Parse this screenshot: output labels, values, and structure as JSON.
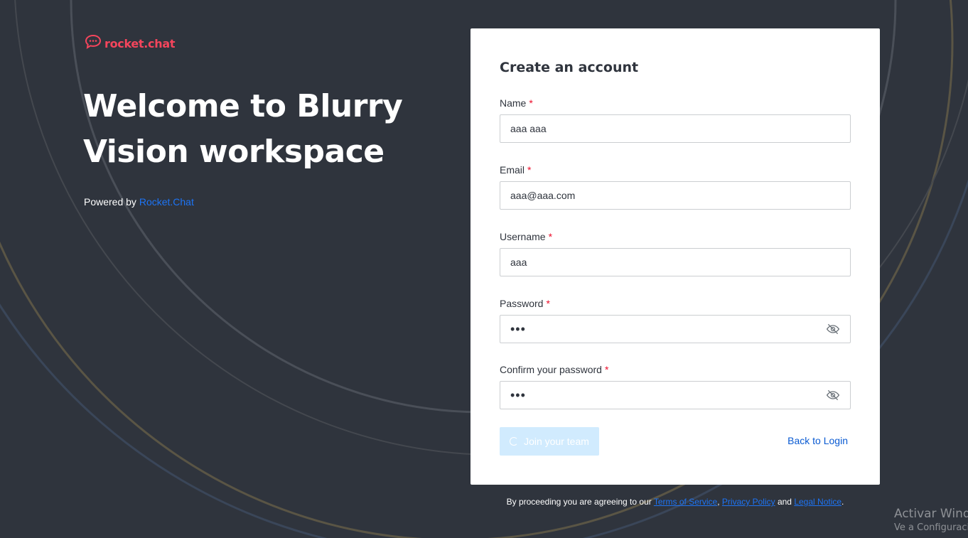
{
  "brand": {
    "logo_text": "rocket.chat",
    "accent_color": "#f5455c"
  },
  "hero": {
    "title": "Welcome to Blurry Vision workspace",
    "powered_by_prefix": "Powered by",
    "powered_by_link": "Rocket.Chat"
  },
  "form": {
    "title": "Create an account",
    "fields": [
      {
        "label": "Name",
        "value": "aaa aaa",
        "required": true
      },
      {
        "label": "Email",
        "value": "aaa@aaa.com",
        "required": true
      },
      {
        "label": "Username",
        "value": "aaa",
        "required": true
      },
      {
        "label": "Password",
        "value": "•••",
        "required": true
      },
      {
        "label": "Confirm your password",
        "value": "•••",
        "required": true
      }
    ],
    "required_marker": "*",
    "submit_label": "Join your team",
    "back_label": "Back to Login"
  },
  "footer": {
    "prefix": "By proceeding you are agreeing to our",
    "terms": "Terms of Service",
    "comma": ",",
    "privacy": "Privacy Policy",
    "and": "and",
    "legal": "Legal Notice",
    "suffix": "."
  },
  "windows_watermark": {
    "title": "Activar Windows",
    "subtitle": "Ve a Configuración"
  },
  "icons": {
    "logo": "rocket-chat-logo-icon",
    "password_toggle": "eye-off-icon",
    "loading": "spinner-icon"
  },
  "colors": {
    "background": "#2f343d",
    "link": "#1d74f5",
    "required": "#ec0d2a",
    "button_disabled": "#d1ebfe"
  }
}
